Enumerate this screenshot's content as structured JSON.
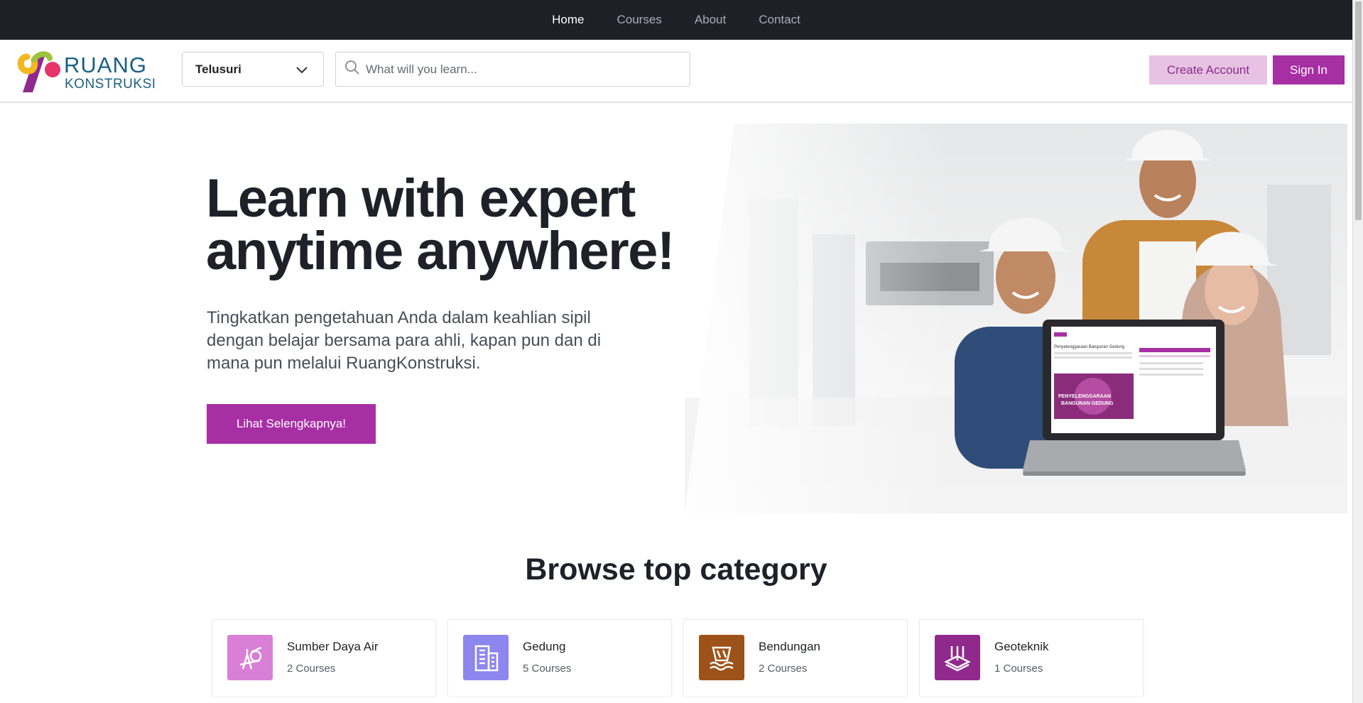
{
  "topnav": {
    "items": [
      {
        "label": "Home",
        "active": true
      },
      {
        "label": "Courses",
        "active": false
      },
      {
        "label": "About",
        "active": false
      },
      {
        "label": "Contact",
        "active": false
      }
    ]
  },
  "header": {
    "logo": {
      "line1": "RUANG",
      "line2": "KONSTRUKSI"
    },
    "select": {
      "value": "Telusuri",
      "icon": "chevron-down-icon"
    },
    "search": {
      "placeholder": "What will you learn...",
      "value": "",
      "icon": "search-icon"
    },
    "create_account_label": "Create Account",
    "sign_in_label": "Sign In"
  },
  "hero": {
    "title_line1": "Learn with expert",
    "title_line2": "anytime anywhere!",
    "subtitle": "Tingkatkan pengetahuan Anda dalam keahlian sipil dengan belajar bersama para ahli, kapan pun dan di mana pun melalui RuangKonstruksi.",
    "cta_label": "Lihat Selengkapnya!",
    "laptop_screen": {
      "heading": "Penyelenggaraan Bangunan Gedung",
      "banner_line1": "PENYELENGGARAAN",
      "banner_line2": "BANGUNAN GEDUNG"
    }
  },
  "category": {
    "title": "Browse top category",
    "items": [
      {
        "name": "Sumber Daya Air",
        "count": "2 Courses",
        "icon": "surveying-icon",
        "color": "#d97fd6"
      },
      {
        "name": "Gedung",
        "count": "5 Courses",
        "icon": "building-icon",
        "color": "#8d86ee"
      },
      {
        "name": "Bendungan",
        "count": "2 Courses",
        "icon": "dam-icon",
        "color": "#9c5218"
      },
      {
        "name": "Geoteknik",
        "count": "1 Courses",
        "icon": "foundation-icon",
        "color": "#8f2a8c"
      }
    ]
  },
  "colors": {
    "accent": "#a72fa4",
    "accent_light": "#e7c2e3",
    "nav_bg": "#1e2028"
  }
}
